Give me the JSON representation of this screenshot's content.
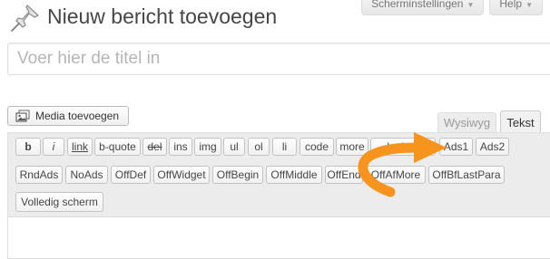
{
  "header": {
    "title": "Nieuw bericht toevoegen",
    "screen_options_label": "Scherminstellingen",
    "help_label": "Help"
  },
  "title_field": {
    "placeholder": "Voer hier de titel in",
    "value": ""
  },
  "media": {
    "add_media_label": "Media toevoegen"
  },
  "editor_tabs": {
    "visual_label": "Wysiwyg",
    "text_label": "Tekst",
    "active": "Tekst"
  },
  "quicktags": {
    "row1": [
      "b",
      "i",
      "link",
      "b-quote",
      "del",
      "ins",
      "img",
      "ul",
      "ol",
      "li",
      "code",
      "more",
      "lookup",
      "Ads1",
      "Ads2"
    ],
    "row2": [
      "RndAds",
      "NoAds",
      "OffDef",
      "OffWidget",
      "OffBegin",
      "OffMiddle",
      "OffEnd",
      "OffAfMore",
      "OffBfLastPara"
    ],
    "row3": [
      "Volledig scherm"
    ]
  },
  "colors": {
    "accent_arrow": "#F7941D",
    "toolbar_bg": "#ECECEC",
    "title_text": "#464646"
  },
  "icons": [
    "pushpin-icon",
    "media-icon",
    "dropdown-arrow-icon",
    "curved-arrow-pointer"
  ]
}
